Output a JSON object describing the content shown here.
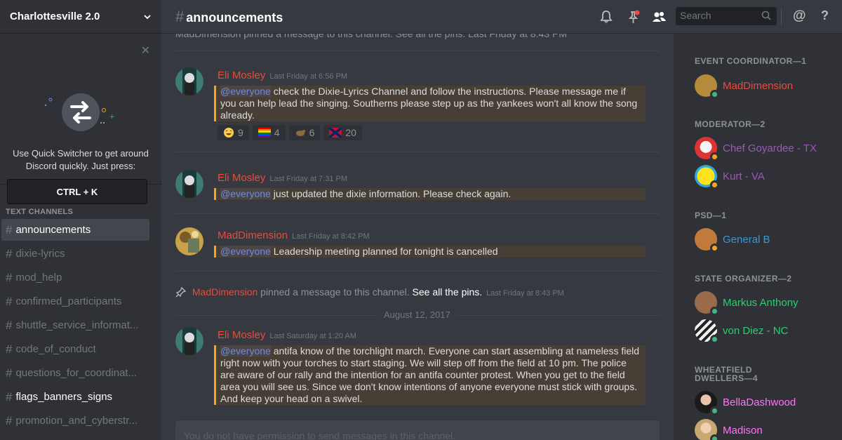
{
  "server": {
    "name": "Charlottesville 2.0"
  },
  "quick_switcher": {
    "text": "Use Quick Switcher to get around Discord quickly. Just press:",
    "shortcut": "CTRL + K"
  },
  "channels": {
    "category": "TEXT CHANNELS",
    "items": [
      {
        "label": "announcements",
        "state": "active"
      },
      {
        "label": "dixie-lyrics",
        "state": "muted"
      },
      {
        "label": "mod_help",
        "state": "muted"
      },
      {
        "label": "confirmed_participants",
        "state": "muted"
      },
      {
        "label": "shuttle_service_informat...",
        "state": "muted"
      },
      {
        "label": "code_of_conduct",
        "state": "muted"
      },
      {
        "label": "questions_for_coordinat...",
        "state": "muted"
      },
      {
        "label": "flags_banners_signs",
        "state": "unread"
      },
      {
        "label": "promotion_and_cyberstr...",
        "state": "muted"
      }
    ]
  },
  "header": {
    "channel": "announcements",
    "search_placeholder": "Search"
  },
  "messages": {
    "top_cut_text": "MadDimension pinned a message to this channel. See all the pins.  Last Friday at 8:43 PM",
    "m1": {
      "author": "Eli Mosley",
      "time": "Last Friday at 6:56 PM",
      "mention": "@everyone",
      "text": " check the Dixie-Lyrics Channel and follow the instructions. Please message me if you can help lead the singing. Southerns please step up as the yankees won't all know the song already.",
      "reactions": [
        {
          "icon": "laughing-emoji",
          "count": "9"
        },
        {
          "icon": "rainbow-flag-emoji",
          "count": "4"
        },
        {
          "icon": "animal-emoji",
          "count": "6"
        },
        {
          "icon": "confederate-flag-emoji",
          "count": "20"
        }
      ]
    },
    "m2": {
      "author": "Eli Mosley",
      "time": "Last Friday at 7:31 PM",
      "mention": "@everyone",
      "text": " just updated the dixie information. Please check again."
    },
    "m3": {
      "author": "MadDimension",
      "time": "Last Friday at 8:42 PM",
      "mention": "@everyone",
      "text": " Leadership meeting planned for tonight is cancelled"
    },
    "system": {
      "actor": "MadDimension",
      "text": " pinned a message to this channel. ",
      "link": "See all the pins.",
      "time": "Last Friday at 8:43 PM"
    },
    "date_separator": "August 12, 2017",
    "m4": {
      "author": "Eli Mosley",
      "time": "Last Saturday at 1:20 AM",
      "mention": "@everyone",
      "text": " antifa know of the torchlight march. Everyone can start assembling at nameless field right now with your torches to start staging. We will step off from the field at 10 pm. The police are aware of our rally and the intention for an antifa counter protest. When you get to the field area you will see us. Since we don't know intentions of anyone everyone must stick with groups. And keep your head on a swivel."
    }
  },
  "composer": {
    "placeholder": "You do not have permission to send messages in this channel."
  },
  "members": {
    "groups": [
      {
        "role": "EVENT COORDINATOR—1",
        "members": [
          {
            "name": "MadDimension",
            "color": "#e74c3c",
            "status": "online"
          }
        ]
      },
      {
        "role": "MODERATOR—2",
        "members": [
          {
            "name": "Chef Goyardee - TX",
            "color": "#9b59b6",
            "status": "idle"
          },
          {
            "name": "Kurt - VA",
            "color": "#9b59b6",
            "status": "idle"
          }
        ]
      },
      {
        "role": "PSD—1",
        "members": [
          {
            "name": "General B",
            "color": "#3498db",
            "status": "idle"
          }
        ]
      },
      {
        "role": "STATE ORGANIZER—2",
        "members": [
          {
            "name": "Markus Anthony",
            "color": "#2ecc71",
            "status": "online"
          },
          {
            "name": "von Diez - NC",
            "color": "#2ecc71",
            "status": "online"
          }
        ]
      },
      {
        "role": "WHEATFIELD DWELLERS—4",
        "members": [
          {
            "name": "BellaDashwood",
            "color": "#ff73fa",
            "status": "online"
          },
          {
            "name": "Madison",
            "color": "#ff73fa",
            "status": "online"
          }
        ]
      }
    ]
  },
  "colors": {
    "accent": "#7289da",
    "author_red": "#e74c3c",
    "mention_bar": "#faa61a",
    "online": "#43b581",
    "idle": "#faa61a"
  }
}
